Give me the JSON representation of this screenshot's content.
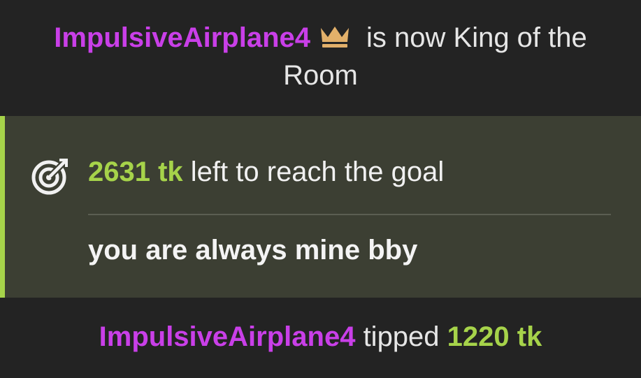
{
  "king_notice": {
    "username": "ImpulsiveAirplane4",
    "icon": "crown-icon",
    "text_line1": "is now King of the",
    "text_line2": "Room"
  },
  "goal": {
    "icon": "target-icon",
    "amount": "2631 tk",
    "text": "left to reach the goal",
    "message": "you are always mine bby"
  },
  "tip": {
    "username": "ImpulsiveAirplane4",
    "verb": "tipped",
    "amount": "1220 tk"
  },
  "colors": {
    "background": "#232323",
    "card_background": "#3c3f33",
    "username": "#c93fe8",
    "token_green": "#a6d34a",
    "crown_gold": "#e2b06a",
    "text": "#e6e6e6"
  }
}
